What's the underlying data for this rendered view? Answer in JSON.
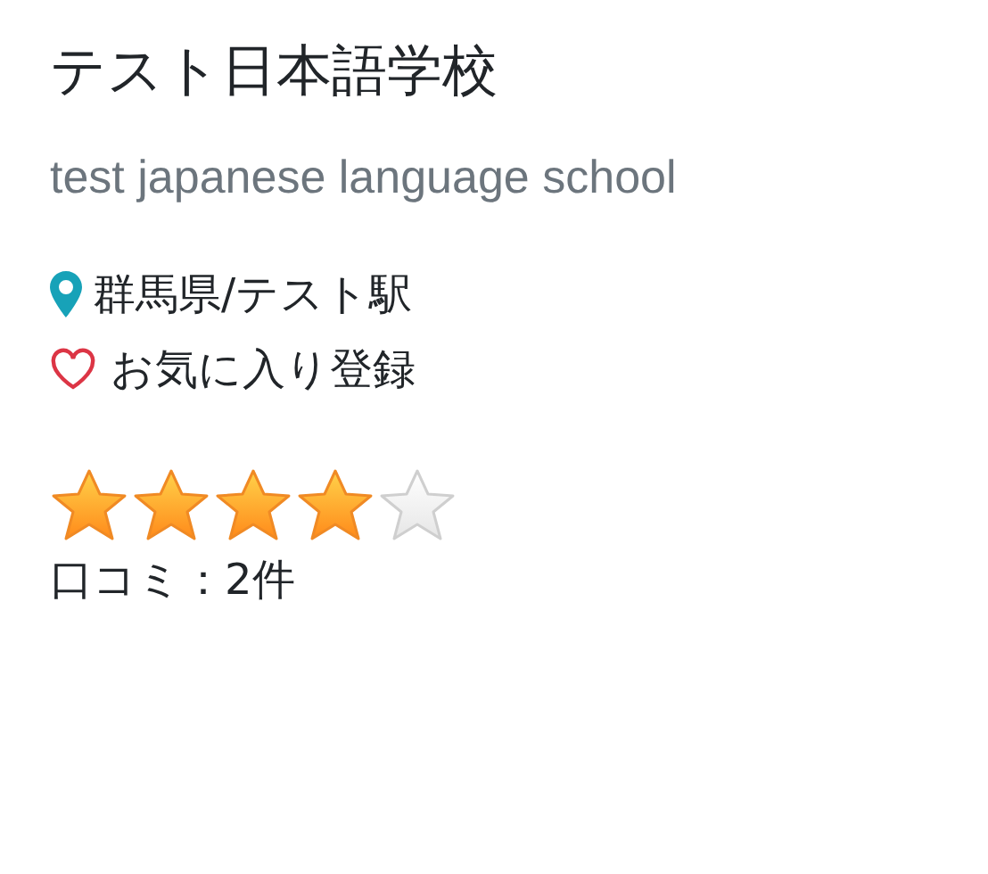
{
  "school": {
    "name": "テスト日本語学校",
    "name_en": "test japanese language school",
    "location": "群馬県/テスト駅",
    "favorite": {
      "label": "お気に入り登録",
      "on": false
    }
  },
  "rating": {
    "stars": 4,
    "reviews": "口コミ：2件"
  }
}
